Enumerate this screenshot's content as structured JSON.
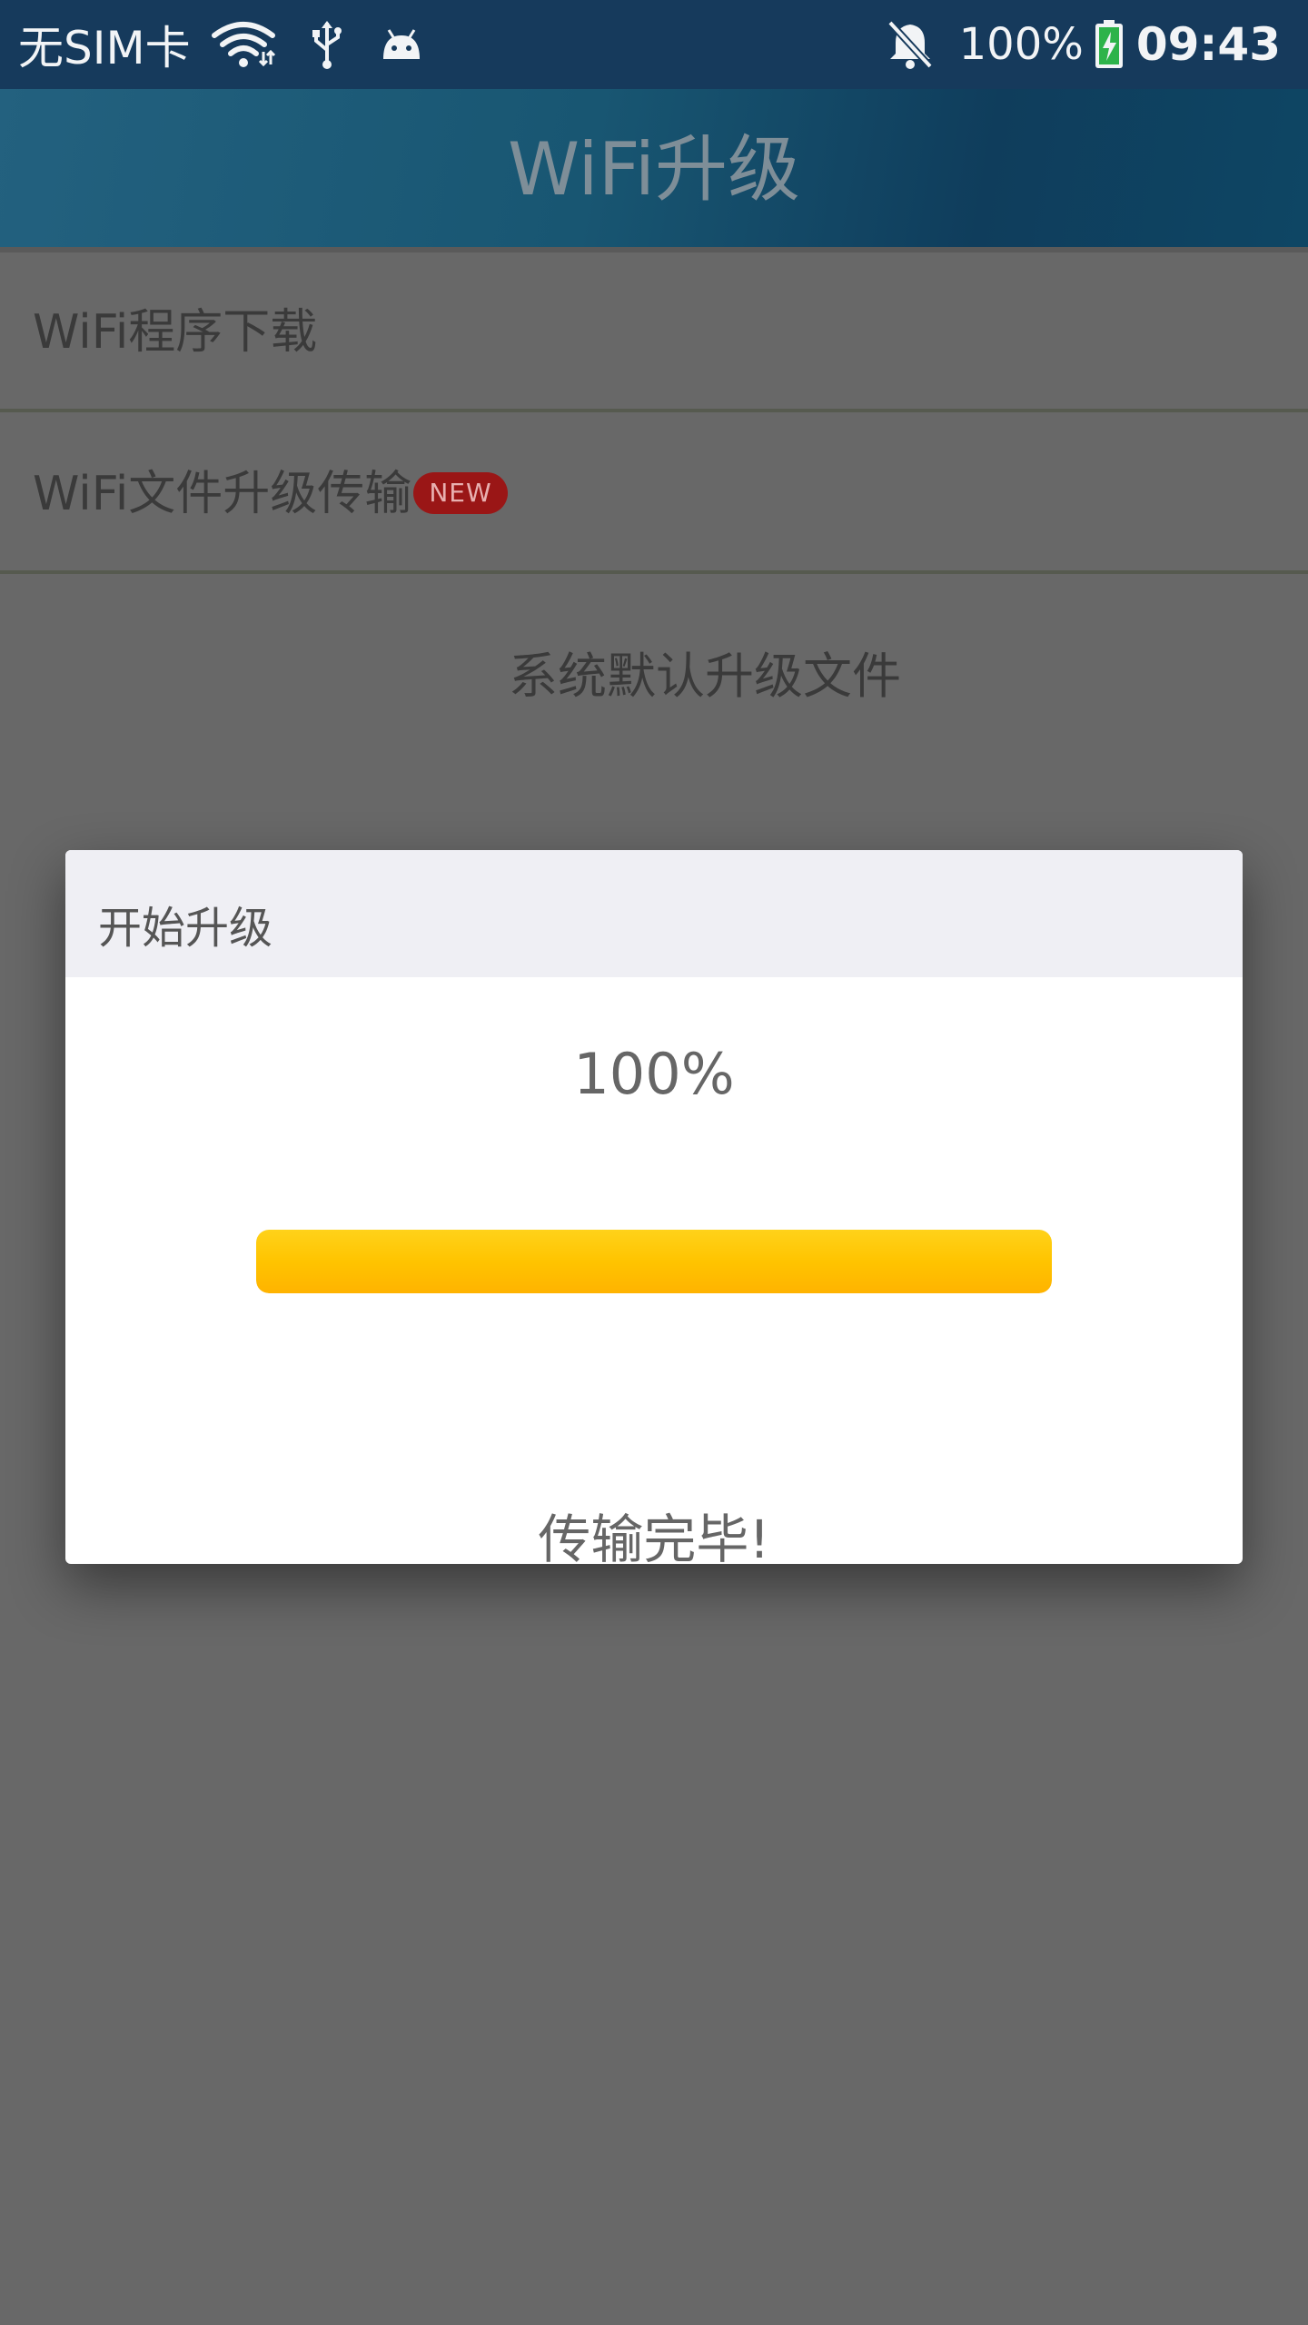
{
  "status_bar": {
    "carrier": "无SIM卡",
    "battery_percent_text": "100%",
    "time": "09:43",
    "icons": [
      "wifi-icon",
      "usb-icon",
      "android-debug-icon",
      "notifications-off-icon",
      "battery-charging-icon"
    ]
  },
  "app_bar": {
    "title": "WiFi升级"
  },
  "list": {
    "items": [
      {
        "label": "WiFi程序下载"
      },
      {
        "label": "WiFi文件升级传输",
        "badge": "NEW"
      }
    ],
    "default_file_label": "系统默认升级文件"
  },
  "dialog": {
    "title": "开始升级",
    "percent_text": "100%",
    "progress": 1.0,
    "status": "传输完毕!"
  },
  "colors": {
    "status_bar": "#163a5c",
    "app_bar": "#185672",
    "scrim_background": "#686868",
    "badge": "#9a1616",
    "progress_fill": "#ffc400"
  }
}
